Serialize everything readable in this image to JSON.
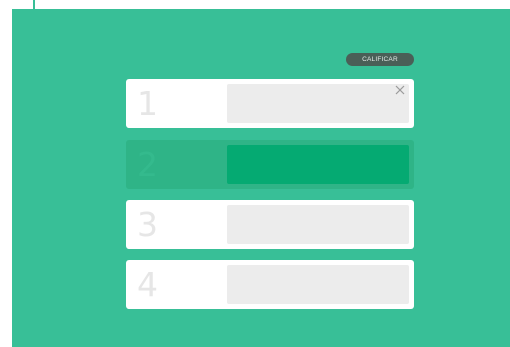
{
  "toolbar": {
    "qualify_label": "CALIFICAR"
  },
  "rows": [
    {
      "number": "1",
      "state": "filled",
      "has_close": true
    },
    {
      "number": "2",
      "state": "active"
    },
    {
      "number": "3",
      "state": "empty"
    },
    {
      "number": "4",
      "state": "empty"
    }
  ],
  "icons": {
    "close": "close-icon"
  },
  "colors": {
    "background": "#38bf97",
    "button": "#4a5f57",
    "active_row": "#2fb487",
    "active_slot": "#05aa72",
    "slot": "#ececec",
    "number": "#e6e6e6"
  }
}
